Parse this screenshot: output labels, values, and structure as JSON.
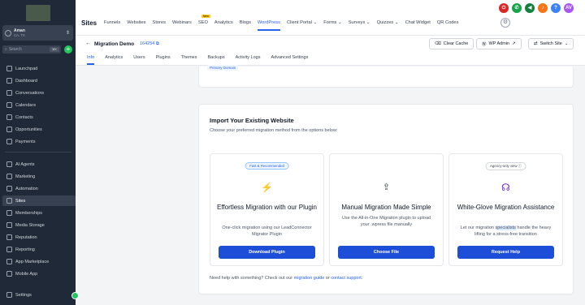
{
  "account": {
    "name": "Aman",
    "location": "CA, TX"
  },
  "sidebar": {
    "search_placeholder": "Search",
    "search_shortcut": "⌘K",
    "items": [
      {
        "label": "Launchpad"
      },
      {
        "label": "Dashboard"
      },
      {
        "label": "Conversations"
      },
      {
        "label": "Calendars"
      },
      {
        "label": "Contacts"
      },
      {
        "label": "Opportunities"
      },
      {
        "label": "Payments"
      },
      {
        "label": "AI Agents"
      },
      {
        "label": "Marketing"
      },
      {
        "label": "Automation"
      },
      {
        "label": "Sites"
      },
      {
        "label": "Memberships"
      },
      {
        "label": "Media Storage"
      },
      {
        "label": "Reputation"
      },
      {
        "label": "Reporting"
      },
      {
        "label": "App Marketplace"
      },
      {
        "label": "Mobile App"
      }
    ],
    "settings_label": "Settings"
  },
  "topbar": {
    "title": "Sites",
    "nav": [
      {
        "label": "Funnels"
      },
      {
        "label": "Websites"
      },
      {
        "label": "Stores"
      },
      {
        "label": "Webinars"
      },
      {
        "label": "SEO",
        "badge": "New"
      },
      {
        "label": "Analytics"
      },
      {
        "label": "Blogs"
      },
      {
        "label": "WordPress"
      },
      {
        "label": "Client Portal ⌄"
      },
      {
        "label": "Forms ⌄"
      },
      {
        "label": "Surveys ⌄"
      },
      {
        "label": "Quizzes ⌄"
      },
      {
        "label": "Chat Widget"
      },
      {
        "label": "QR Codes"
      }
    ],
    "avatar_initials": "AV"
  },
  "subheader": {
    "site_name": "Migration Demo",
    "site_id": "164254",
    "buttons": {
      "clear_cache": "Clear Cache",
      "wp_admin": "WP Admin",
      "switch_site": "Switch Site"
    },
    "tabs": [
      "Info",
      "Analytics",
      "Users",
      "Plugins",
      "Themes",
      "Backups",
      "Activity Logs",
      "Advanced Settings"
    ]
  },
  "primary_domain_badge": "Primary Domain",
  "import": {
    "title": "Import Your Existing Website",
    "subtitle": "Choose your preferred migration method from the options below:",
    "options": [
      {
        "badge": "Fast & Recommended",
        "title": "Effortless Migration with our Plugin",
        "desc": "One-click migration using our LeadConnector Migrator Plugin",
        "button": "Download Plugin"
      },
      {
        "badge": "",
        "title": "Manual Migration Made Simple",
        "desc": "Use the All-in-One Migration plugin to upload your .wpress file manually",
        "button": "Choose File"
      },
      {
        "badge": "Agency-only view",
        "title": "White-Glove Migration Assistance",
        "desc_pre": "Let our migration ",
        "desc_hl": "specialists",
        "desc_post": " handle the heavy lifting for a stress-free transition",
        "button": "Request Help"
      }
    ],
    "help_pre": "Need help with something? Check out our ",
    "help_link1": "migration guide",
    "help_mid": " or ",
    "help_link2": "contact support",
    "help_end": "."
  }
}
